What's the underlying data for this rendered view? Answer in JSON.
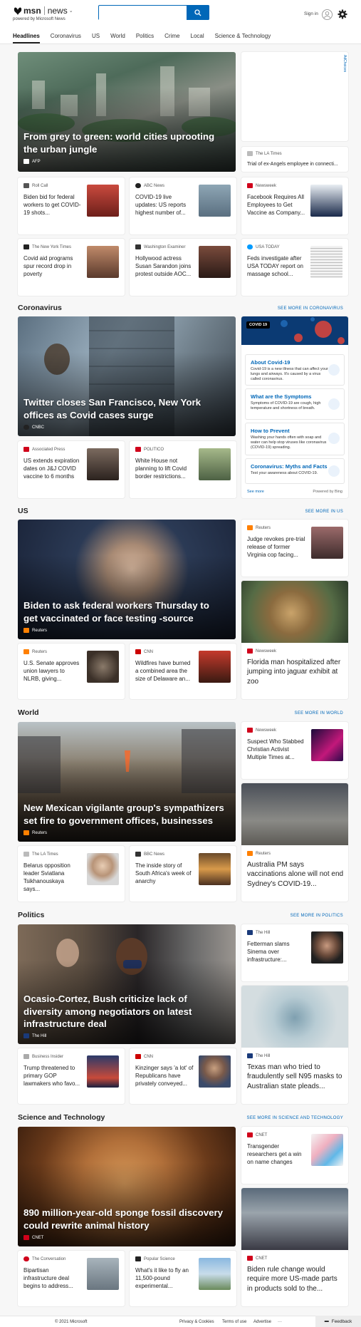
{
  "header": {
    "brand": "msn",
    "section": "news",
    "caret": "⌄",
    "powered_by": "powered by Microsoft News",
    "search_placeholder": "",
    "signin": "Sign in"
  },
  "nav": [
    "Headlines",
    "Coronavirus",
    "US",
    "World",
    "Politics",
    "Crime",
    "Local",
    "Science & Technology"
  ],
  "ad": {
    "choices": "AdChoices"
  },
  "top": {
    "hero": {
      "title": "From grey to green: world cities uprooting the urban jungle",
      "source": "AFP"
    },
    "right_text": {
      "source": "The LA Times",
      "title": "Trial of ex-Angels employee in connecti..."
    },
    "cards": [
      {
        "source": "Roll Call",
        "title": "Biden bid for federal workers to get COVID-19 shots..."
      },
      {
        "source": "ABC News",
        "title": "COVID-19 live updates: US reports highest number of..."
      },
      {
        "source": "Newsweek",
        "title": "Facebook Requires All Employees to Get Vaccine as Company..."
      },
      {
        "source": "The New York Times",
        "title": "Covid aid programs spur record drop in poverty"
      },
      {
        "source": "Washington Examiner",
        "title": "Hollywood actress Susan Sarandon joins protest outside AOC..."
      },
      {
        "source": "USA TODAY",
        "title": "Feds investigate after USA TODAY report on massage school..."
      }
    ]
  },
  "coronavirus": {
    "heading": "Coronavirus",
    "see_more": "SEE MORE IN CORONAVIRUS",
    "hero": {
      "title": "Twitter closes San Francisco, New York offices as Covid cases surge",
      "source": "CNBC"
    },
    "cards": [
      {
        "source": "Associated Press",
        "title": "US extends expiration dates on J&J COVID vaccine to 6 months"
      },
      {
        "source": "POLITICO",
        "title": "White House not planning to lift Covid border restrictions..."
      }
    ],
    "widget": {
      "badge": "COVID 19",
      "items": [
        {
          "title": "About Covid-19",
          "desc": "Covid-19 is a new illness that can affect your lungs and airways. It's caused by a virus called coronavirus."
        },
        {
          "title": "What are the Symptoms",
          "desc": "Symptoms of COVID-19 are cough, high temperature and shortness of breath."
        },
        {
          "title": "How to Prevent",
          "desc": "Washing your hands often with soap and water can help stop viruses like coronavirus (COVID-19) spreading."
        },
        {
          "title": "Coronavirus: Myths and Facts",
          "desc": "Test your awareness about COVID-19."
        }
      ],
      "see_more": "See more",
      "powered": "Powered by Bing"
    }
  },
  "us": {
    "heading": "US",
    "see_more": "SEE MORE IN US",
    "hero": {
      "title": "Biden to ask federal workers Thursday to get vaccinated or face testing -source",
      "source": "Reuters"
    },
    "right_card": {
      "source": "Reuters",
      "title": "Judge revokes pre-trial release of former Virginia cop facing..."
    },
    "right_img": {
      "source": "Newsweek",
      "title": "Florida man hospitalized after jumping into jaguar exhibit at zoo"
    },
    "cards": [
      {
        "source": "Reuters",
        "title": "U.S. Senate approves union lawyers to NLRB, giving..."
      },
      {
        "source": "CNN",
        "title": "Wildfires have burned a combined area the size of Delaware an..."
      }
    ]
  },
  "world": {
    "heading": "World",
    "see_more": "SEE MORE IN WORLD",
    "hero": {
      "title": "New Mexican vigilante group's sympathizers set fire to government offices, businesses",
      "source": "Reuters"
    },
    "right_card": {
      "source": "Newsweek",
      "title": "Suspect Who Stabbed Christian Activist Multiple Times at..."
    },
    "right_img": {
      "source": "Reuters",
      "title": "Australia PM says vaccinations alone will not end Sydney's COVID-19..."
    },
    "cards": [
      {
        "source": "The LA Times",
        "title": "Belarus opposition leader Sviatlana Tsikhanouskaya says..."
      },
      {
        "source": "BBC News",
        "title": "The inside story of South Africa's week of anarchy"
      }
    ]
  },
  "politics": {
    "heading": "Politics",
    "see_more": "SEE MORE IN POLITICS",
    "hero": {
      "title": "Ocasio-Cortez, Bush criticize lack of diversity among negotiators on latest infrastructure deal",
      "source": "The Hill"
    },
    "right_card": {
      "source": "The Hill",
      "title": "Fetterman slams Sinema over infrastructure:..."
    },
    "right_img": {
      "source": "The Hill",
      "title": "Texas man who tried to fraudulently sell N95 masks to Australian state pleads..."
    },
    "cards": [
      {
        "source": "Business Insider",
        "title": "Trump threatened to primary GOP lawmakers who favo..."
      },
      {
        "source": "CNN",
        "title": "Kinzinger says 'a lot' of Republicans have privately conveyed..."
      }
    ]
  },
  "scitech": {
    "heading": "Science and Technology",
    "see_more": "SEE MORE IN SCIENCE AND TECHNOLOGY",
    "hero": {
      "title": "890 million-year-old sponge fossil discovery could rewrite animal history",
      "source": "CNET"
    },
    "right_card": {
      "source": "CNET",
      "title": "Transgender researchers get a win on name changes"
    },
    "right_img": {
      "source": "CNET",
      "title": "Biden rule change would require more US-made parts in products sold to the..."
    },
    "cards": [
      {
        "source": "The Conversation",
        "title": "Bipartisan infrastructure deal begins to address..."
      },
      {
        "source": "Popular Science",
        "title": "What's it like to fly an 11,500-pound experimental..."
      }
    ]
  },
  "footer": {
    "copyright": "© 2021 Microsoft",
    "links": [
      "Privacy & Cookies",
      "Terms of use",
      "Advertise",
      "···"
    ],
    "feedback": "Feedback"
  },
  "colors": {
    "accent": "#0067b8",
    "cnn": "#cc0000",
    "newsweek": "#d0021b",
    "usatoday": "#009bff"
  }
}
